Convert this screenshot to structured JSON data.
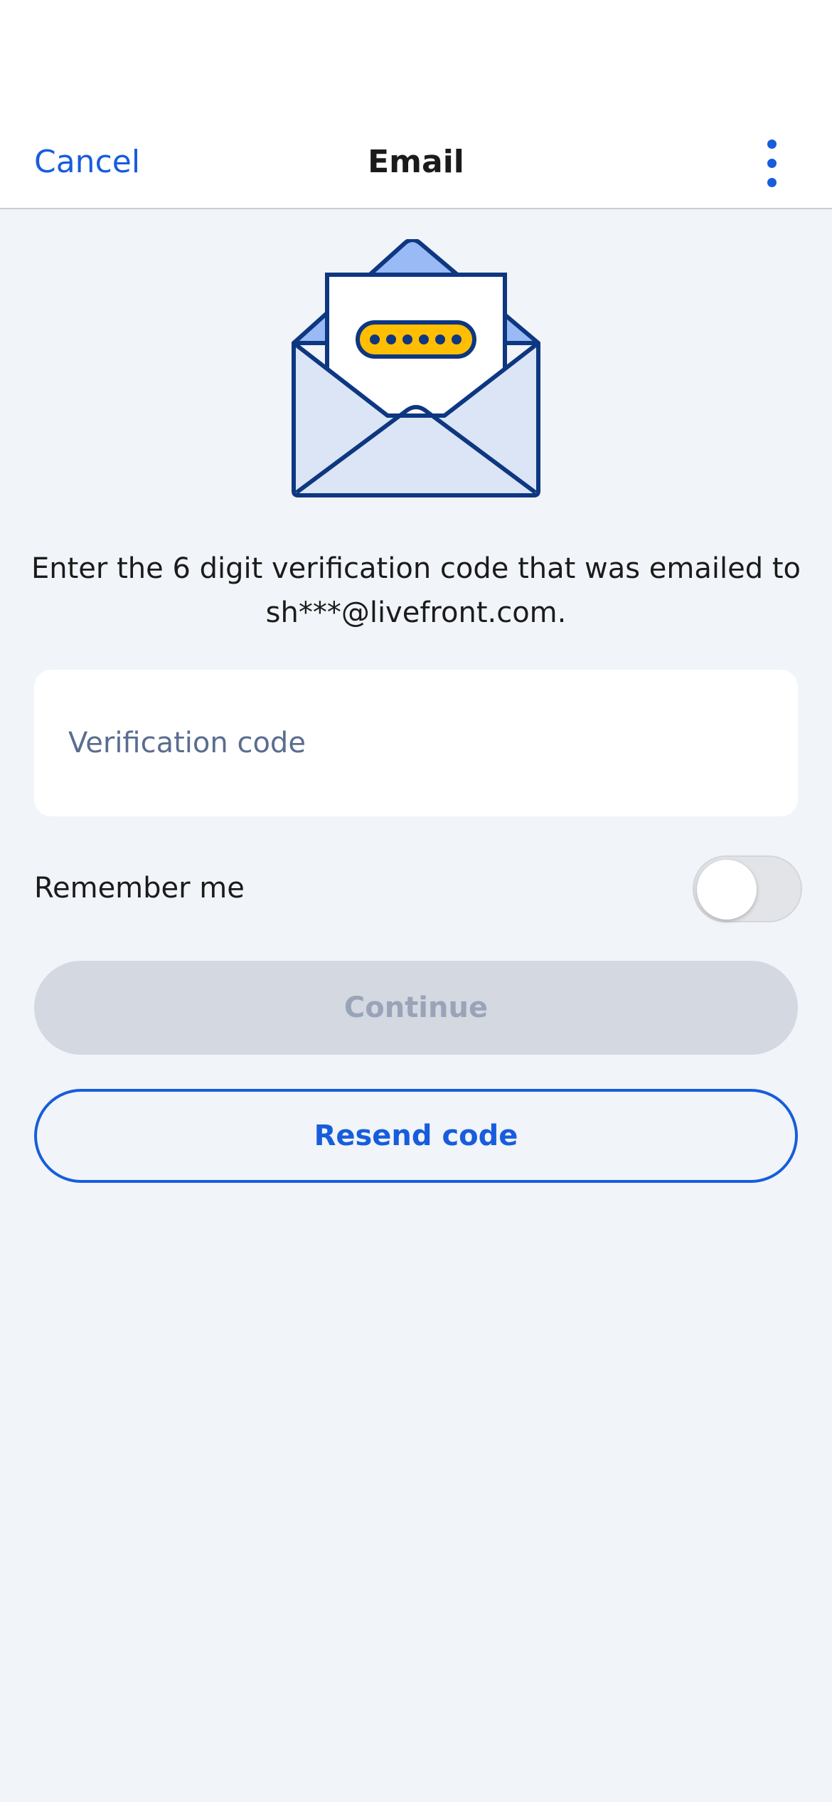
{
  "nav": {
    "cancel_label": "Cancel",
    "title": "Email",
    "more_icon": "more-vertical-icon"
  },
  "illustration": {
    "icon": "open-envelope-verification-code-icon",
    "code_dots": 6
  },
  "message": {
    "line1": "Enter the 6 digit verification code that was emailed to",
    "line2": "sh***@livefront.com."
  },
  "verification_field": {
    "value": "",
    "placeholder": "Verification code"
  },
  "remember_me": {
    "label": "Remember me",
    "enabled": false
  },
  "buttons": {
    "continue_label": "Continue",
    "resend_label": "Resend code"
  },
  "colors": {
    "accent": "#175ddc",
    "background": "#f1f4f8",
    "surface": "#ffffff",
    "disabled_button": "#d3d8e1",
    "disabled_text": "#9aa4b8",
    "illustration_outline": "#0e3781",
    "illustration_fill_light": "#dbe5f6",
    "illustration_fill_mid": "#99baf4",
    "illustration_code_pill": "#ffbf00"
  }
}
